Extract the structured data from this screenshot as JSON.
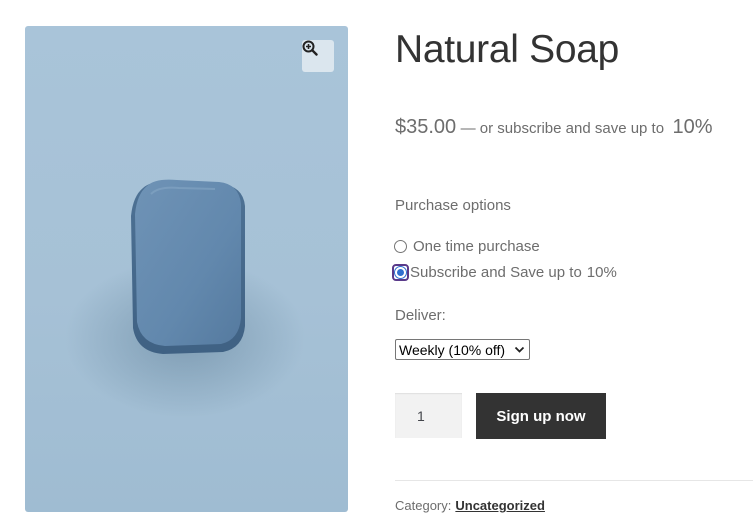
{
  "product": {
    "title": "Natural Soap",
    "image_alt": "Blue bar of soap on a light blue background"
  },
  "price": {
    "amount": "$35.00",
    "suffix": "— or subscribe and save up to",
    "discount": "10%"
  },
  "purchase_options": {
    "label": "Purchase options",
    "options": [
      {
        "label": "One time purchase",
        "selected": false
      },
      {
        "label": "Subscribe and Save up to",
        "discount": "10%",
        "selected": true
      }
    ]
  },
  "deliver": {
    "label": "Deliver:",
    "selected": "Weekly (10% off)"
  },
  "cart": {
    "quantity": "1",
    "button_label": "Sign up now"
  },
  "meta": {
    "category_label": "Category:",
    "category_value": "Uncategorized"
  },
  "icons": {
    "zoom": "zoom-in-icon",
    "select": "chevron-down-icon"
  },
  "colors": {
    "image_bg": "#a9c4d9",
    "button_bg": "#333333",
    "radio_selected": "#2f6fcf"
  }
}
